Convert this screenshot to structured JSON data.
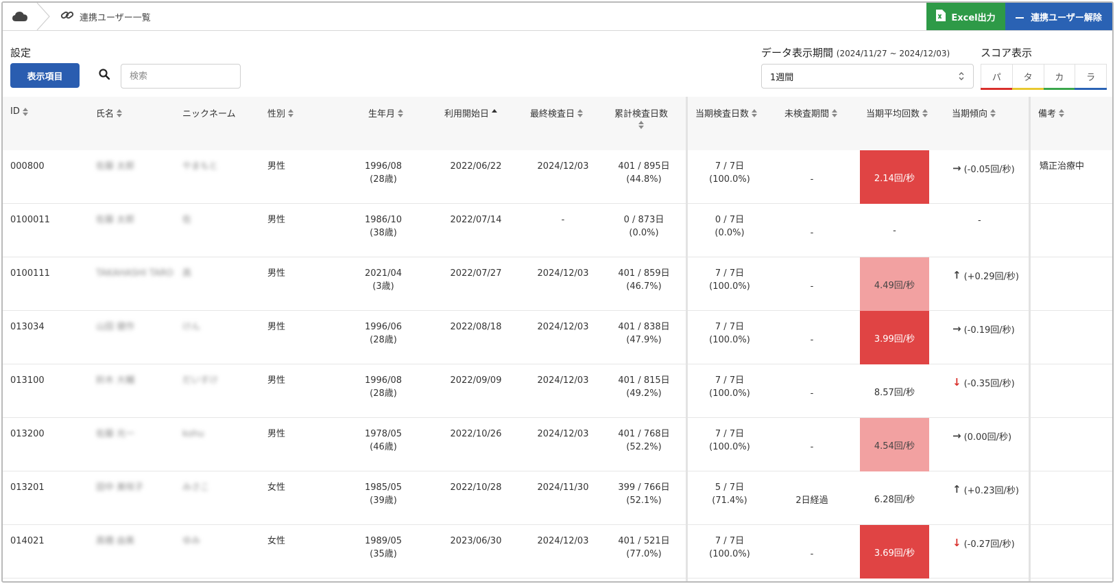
{
  "topbar": {
    "breadcrumb": "連携ユーザー一覧",
    "excel_button": "Excel出力",
    "unlink_button": "連携ユーザー解除"
  },
  "settings": {
    "label": "設定",
    "columns_button": "表示項目",
    "search_placeholder": "検索"
  },
  "period": {
    "label": "データ表示期間",
    "range": "(2024/11/27 ~ 2024/12/03)",
    "selected": "1週間"
  },
  "score": {
    "label": "スコア表示",
    "tabs": [
      {
        "label": "パ",
        "color": "#d9302c"
      },
      {
        "label": "タ",
        "color": "#e8c830"
      },
      {
        "label": "カ",
        "color": "#3aa64b"
      },
      {
        "label": "ラ",
        "color": "#2a62b4"
      }
    ]
  },
  "columns": {
    "id": "ID",
    "name": "氏名",
    "nickname": "ニックネーム",
    "gender": "性別",
    "birth": "生年月",
    "start": "利用開始日",
    "last": "最終検査日",
    "total": "累計検査日数",
    "period_days": "当期検査日数",
    "unchecked": "未検査期間",
    "avg": "当期平均回数",
    "trend": "当期傾向",
    "note": "備考"
  },
  "rows": [
    {
      "id": "000800",
      "name": "佐藤 太郎",
      "nickname": "やまもと",
      "gender": "男性",
      "birth": "1996/08",
      "age": "(28歳)",
      "start": "2022/06/22",
      "last": "2024/12/03",
      "total": "401 / 895日",
      "total_pct": "(44.8%)",
      "period_days": "7 / 7日",
      "period_pct": "(100.0%)",
      "unchecked": "-",
      "avg": "2.14回/秒",
      "avg_level": "high",
      "trend_icon": "→",
      "trend_color": "dark",
      "trend": "(-0.05回/秒)",
      "note": "矯正治療中"
    },
    {
      "id": "0100011",
      "name": "佐藤 太郎",
      "nickname": "佐",
      "gender": "男性",
      "birth": "1986/10",
      "age": "(38歳)",
      "start": "2022/07/14",
      "last": "-",
      "total": "0 / 873日",
      "total_pct": "(0.0%)",
      "period_days": "0 / 7日",
      "period_pct": "(0.0%)",
      "unchecked": "-",
      "avg": "-",
      "avg_level": "none",
      "trend_icon": "",
      "trend_color": "dark",
      "trend": "-",
      "note": ""
    },
    {
      "id": "0100111",
      "name": "TAKAHASHI TARO",
      "nickname": "高",
      "gender": "男性",
      "birth": "2021/04",
      "age": "(3歳)",
      "start": "2022/07/27",
      "last": "2024/12/03",
      "total": "401 / 859日",
      "total_pct": "(46.7%)",
      "period_days": "7 / 7日",
      "period_pct": "(100.0%)",
      "unchecked": "-",
      "avg": "4.49回/秒",
      "avg_level": "mid",
      "trend_icon": "↑",
      "trend_color": "dark",
      "trend": "(+0.29回/秒)",
      "note": ""
    },
    {
      "id": "013034",
      "name": "山田 健作",
      "nickname": "けん",
      "gender": "男性",
      "birth": "1996/06",
      "age": "(28歳)",
      "start": "2022/08/18",
      "last": "2024/12/03",
      "total": "401 / 838日",
      "total_pct": "(47.9%)",
      "period_days": "7 / 7日",
      "period_pct": "(100.0%)",
      "unchecked": "-",
      "avg": "3.99回/秒",
      "avg_level": "high",
      "trend_icon": "→",
      "trend_color": "dark",
      "trend": "(-0.19回/秒)",
      "note": ""
    },
    {
      "id": "013100",
      "name": "鈴木 大輔",
      "nickname": "だいすけ",
      "gender": "男性",
      "birth": "1996/08",
      "age": "(28歳)",
      "start": "2022/09/09",
      "last": "2024/12/03",
      "total": "401 / 815日",
      "total_pct": "(49.2%)",
      "period_days": "7 / 7日",
      "period_pct": "(100.0%)",
      "unchecked": "-",
      "avg": "8.57回/秒",
      "avg_level": "none",
      "trend_icon": "↓",
      "trend_color": "red",
      "trend": "(-0.35回/秒)",
      "note": ""
    },
    {
      "id": "013200",
      "name": "佐藤 光一",
      "nickname": "kohu",
      "gender": "男性",
      "birth": "1978/05",
      "age": "(46歳)",
      "start": "2022/10/26",
      "last": "2024/12/03",
      "total": "401 / 768日",
      "total_pct": "(52.2%)",
      "period_days": "7 / 7日",
      "period_pct": "(100.0%)",
      "unchecked": "-",
      "avg": "4.54回/秒",
      "avg_level": "mid",
      "trend_icon": "→",
      "trend_color": "dark",
      "trend": "(0.00回/秒)",
      "note": ""
    },
    {
      "id": "013201",
      "name": "田中 美咲子",
      "nickname": "みさこ",
      "gender": "女性",
      "birth": "1985/05",
      "age": "(39歳)",
      "start": "2022/10/28",
      "last": "2024/11/30",
      "total": "399 / 766日",
      "total_pct": "(52.1%)",
      "period_days": "5 / 7日",
      "period_pct": "(71.4%)",
      "unchecked": "2日経過",
      "avg": "6.28回/秒",
      "avg_level": "none",
      "trend_icon": "↑",
      "trend_color": "dark",
      "trend": "(+0.23回/秒)",
      "note": ""
    },
    {
      "id": "014021",
      "name": "高橋 由美",
      "nickname": "ゆみ",
      "gender": "女性",
      "birth": "1989/05",
      "age": "(35歳)",
      "start": "2023/06/30",
      "last": "2024/12/03",
      "total": "401 / 521日",
      "total_pct": "(77.0%)",
      "period_days": "7 / 7日",
      "period_pct": "(100.0%)",
      "unchecked": "-",
      "avg": "3.69回/秒",
      "avg_level": "high",
      "trend_icon": "↓",
      "trend_color": "red",
      "trend": "(-0.27回/秒)",
      "note": ""
    }
  ]
}
